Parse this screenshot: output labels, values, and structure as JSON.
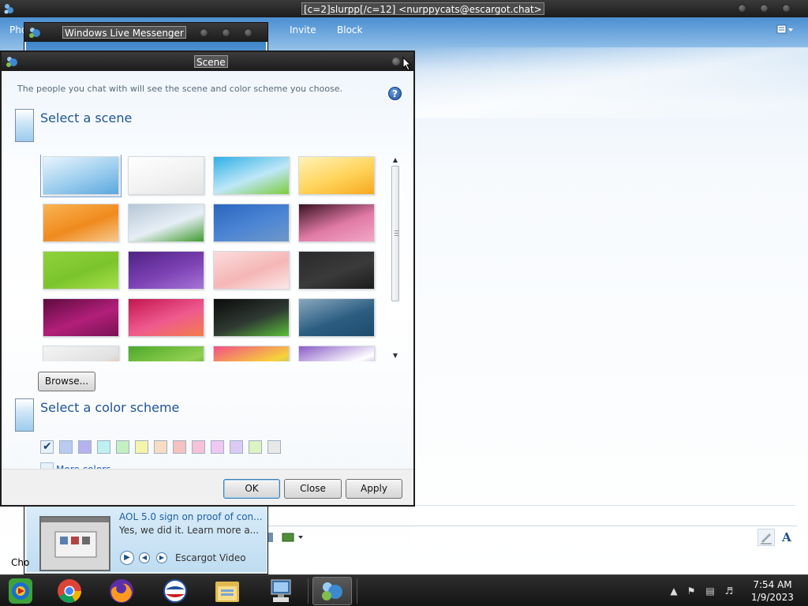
{
  "conversation": {
    "title": "[c=2]slurpp[/c=12] <nurppycats@escargot.chat>",
    "menu": [
      "Pho",
      "Invite",
      "Block"
    ],
    "bottom_label": "Cho"
  },
  "messenger": {
    "title": "Windows Live Messenger",
    "ad": {
      "title": "AOL 5.0 sign on proof of con...",
      "description": "Yes, we did it. Learn more a...",
      "source": "Escargot Video"
    }
  },
  "scene_dialog": {
    "title": "Scene",
    "description": "The people you chat with will see the scene and color scheme you choose.",
    "help_icon": "?",
    "scene_heading": "Select a scene",
    "browse_label": "Browse...",
    "color_heading": "Select a color scheme",
    "more_colors_label": "More colors...",
    "buttons": {
      "ok": "OK",
      "close": "Close",
      "apply": "Apply"
    },
    "scenes": [
      {
        "name": "sky-blue",
        "colors": [
          "#e9f5fc",
          "#9ccdee",
          "#5aa7dd"
        ],
        "selected": true
      },
      {
        "name": "white-clouds",
        "colors": [
          "#ffffff",
          "#f2f2f2",
          "#e3e3e3"
        ]
      },
      {
        "name": "green-hill-sky",
        "colors": [
          "#2fb0e6",
          "#bfe7f8",
          "#7ccc3a"
        ]
      },
      {
        "name": "orange-tree",
        "colors": [
          "#fff2b8",
          "#ffd35a",
          "#f6a81e"
        ]
      },
      {
        "name": "orange-grass",
        "colors": [
          "#f9b453",
          "#f08a1d",
          "#f7c98f"
        ]
      },
      {
        "name": "field-cloudy",
        "colors": [
          "#b6c7d6",
          "#e6eef5",
          "#3f9a2d"
        ]
      },
      {
        "name": "blue-mountains",
        "colors": [
          "#2a66c0",
          "#4d86d4",
          "#6f97c8"
        ]
      },
      {
        "name": "pink-pattern",
        "colors": [
          "#3a1220",
          "#e07aa6",
          "#f2a7c7"
        ]
      },
      {
        "name": "lime-dots",
        "colors": [
          "#8fd23c",
          "#7cc42c",
          "#a6e04a"
        ]
      },
      {
        "name": "purple-swirl",
        "colors": [
          "#4e2383",
          "#7d41b4",
          "#a574d6"
        ]
      },
      {
        "name": "pink-blossom",
        "colors": [
          "#fbdcdc",
          "#f5b6b6",
          "#fde8e8"
        ]
      },
      {
        "name": "dark-pattern",
        "colors": [
          "#2a2a2a",
          "#3a3a3a",
          "#1c1c1c"
        ]
      },
      {
        "name": "magenta-heart",
        "colors": [
          "#5e0b3f",
          "#b21f7a",
          "#7a1153"
        ]
      },
      {
        "name": "red-burst",
        "colors": [
          "#c4164f",
          "#ef5a8f",
          "#f47d4c"
        ]
      },
      {
        "name": "dark-green-wave",
        "colors": [
          "#0b0b0b",
          "#2f3a33",
          "#5bbf3a"
        ]
      },
      {
        "name": "ocean-plane",
        "colors": [
          "#8aa7be",
          "#2c5e82",
          "#1d4b6e"
        ]
      },
      {
        "name": "white-orange",
        "colors": [
          "#f4f4f4",
          "#e1e1e1",
          "#f08a1d"
        ]
      },
      {
        "name": "green-bamboo",
        "colors": [
          "#4ca82b",
          "#92d050",
          "#2f7f1f"
        ]
      },
      {
        "name": "colorful-pop",
        "colors": [
          "#f24f86",
          "#f7d23a",
          "#39b6e6"
        ]
      },
      {
        "name": "purple-cartoon",
        "colors": [
          "#8a5cc8",
          "#ffffff",
          "#6a3aa8"
        ]
      }
    ],
    "color_schemes": [
      {
        "name": "default",
        "color": "#e8f1fa",
        "selected": true
      },
      {
        "name": "blue",
        "color": "#b9ccf0"
      },
      {
        "name": "violet",
        "color": "#b6b2ef"
      },
      {
        "name": "aqua",
        "color": "#bff0ef"
      },
      {
        "name": "green",
        "color": "#c3efc1"
      },
      {
        "name": "yellow",
        "color": "#f6f4a8"
      },
      {
        "name": "peach",
        "color": "#f8dcc4"
      },
      {
        "name": "salmon",
        "color": "#f5c2c0"
      },
      {
        "name": "pink",
        "color": "#f6c2d8"
      },
      {
        "name": "lilac",
        "color": "#efc8f2"
      },
      {
        "name": "lavender",
        "color": "#dccaf5"
      },
      {
        "name": "lime",
        "color": "#dcf3c2"
      },
      {
        "name": "gray",
        "color": "#e8e8e8"
      }
    ]
  },
  "taskbar": {
    "apps": [
      "windows-media-center-icon",
      "chrome-icon",
      "firefox-icon",
      "aol-icon",
      "file-explorer-icon",
      "network-connection-icon",
      "messenger-icon"
    ],
    "clock_time": "7:54 AM",
    "clock_date": "1/9/2023"
  }
}
